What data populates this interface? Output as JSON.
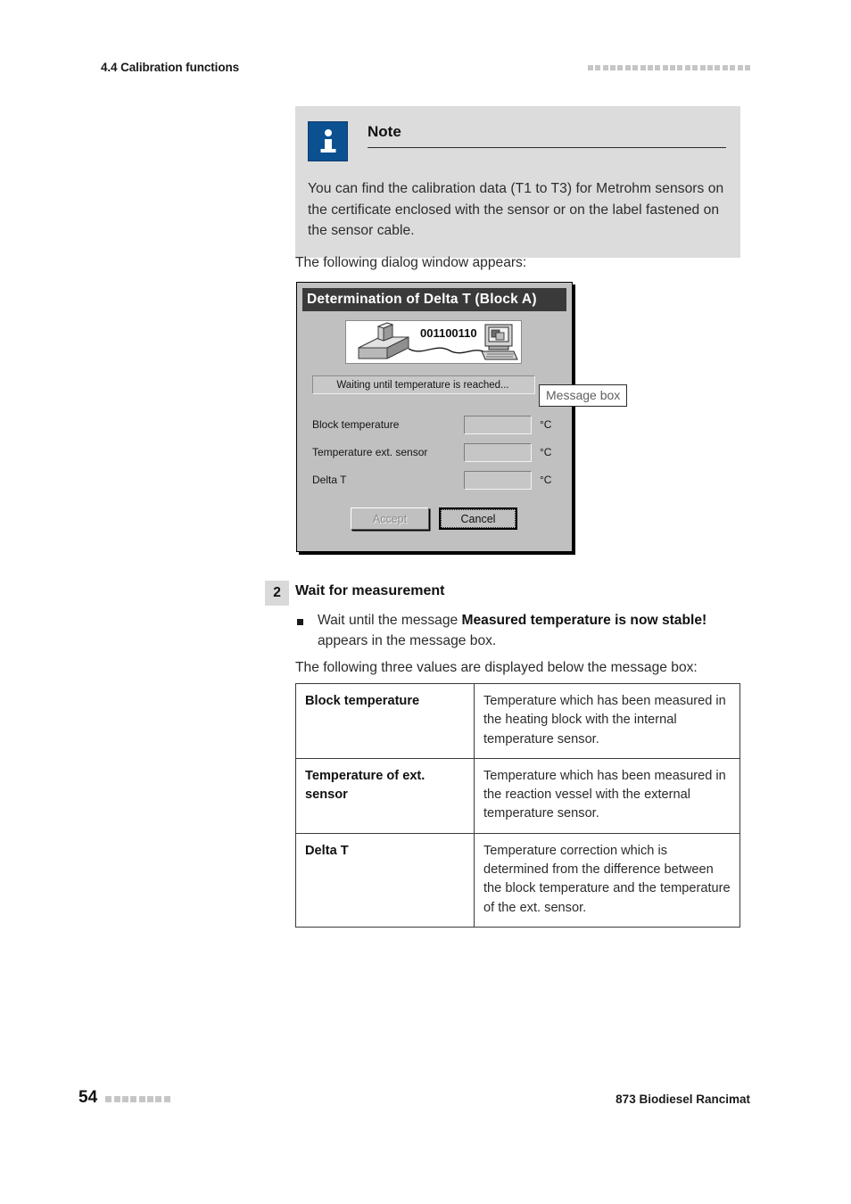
{
  "header": {
    "chapter": "4.4 Calibration functions",
    "square_count": 22
  },
  "note": {
    "icon": "info-icon",
    "title": "Note",
    "body": "You can find the calibration data (T1 to T3) for Metrohm sensors on the certificate enclosed with the sensor or on the label fastened on the sensor cable.",
    "background_color": "#dcdcdc",
    "icon_color": "#0b5091"
  },
  "intro_paragraph": "The following dialog window appears:",
  "dialog": {
    "title": "Determination of Delta T (Block A)",
    "illustration": {
      "binary_text": "001100110",
      "device_icon": "heating-block-icon",
      "computer_icon": "computer-icon"
    },
    "message_text": "Waiting until temperature is reached...",
    "fields": [
      {
        "label": "Block temperature",
        "value": "",
        "unit": "°C"
      },
      {
        "label": "Temperature ext. sensor",
        "value": "",
        "unit": "°C"
      },
      {
        "label": "Delta T",
        "value": "",
        "unit": "°C"
      }
    ],
    "buttons": {
      "accept": "Accept",
      "cancel": "Cancel"
    }
  },
  "callout": {
    "message_box": "Message box"
  },
  "step": {
    "number": "2",
    "title": "Wait for measurement",
    "bullet": {
      "lead": "Wait until the message ",
      "emphasis": "Measured temperature is now stable!",
      "tail": " appears in the message box."
    }
  },
  "values_intro": "The following three values are displayed below the message box:",
  "description_table": {
    "rows": [
      {
        "term": "Block temperature",
        "description": "Temperature which has been measured in the heating block with the internal temperature sensor."
      },
      {
        "term": "Temperature of ext. sensor",
        "description": "Temperature which has been measured in the reaction vessel with the external temperature sensor."
      },
      {
        "term": "Delta T",
        "description": "Temperature correction which is determined from the difference between the block temperature and the temperature of the ext. sensor."
      }
    ]
  },
  "footer": {
    "page_number": "54",
    "square_count": 8,
    "document_title": "873 Biodiesel Rancimat"
  }
}
